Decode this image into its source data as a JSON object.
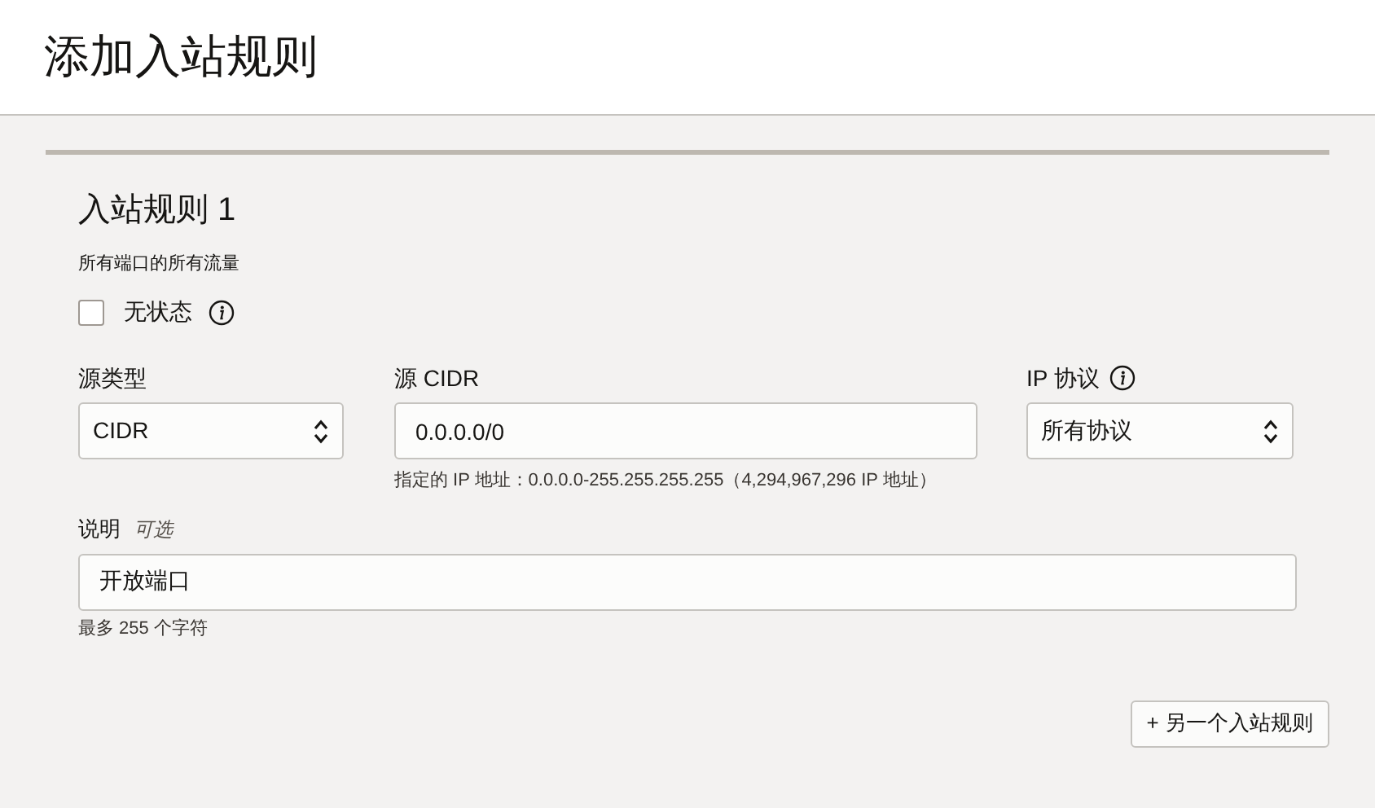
{
  "page": {
    "title": "添加入站规则"
  },
  "rule": {
    "heading": "入站规则 1",
    "summary": "所有端口的所有流量",
    "stateless": {
      "label": "无状态",
      "checked": false
    },
    "source_type": {
      "label": "源类型",
      "value": "CIDR"
    },
    "source_cidr": {
      "label": "源 CIDR",
      "value": "0.0.0.0/0",
      "help": "指定的 IP 地址：0.0.0.0-255.255.255.255（4,294,967,296 IP 地址）"
    },
    "ip_protocol": {
      "label": "IP 协议",
      "value": "所有协议"
    },
    "description": {
      "label": "说明",
      "optional": "可选",
      "value": "开放端口",
      "help": "最多 255 个字符"
    }
  },
  "add_button": {
    "label": "+ 另一个入站规则"
  }
}
